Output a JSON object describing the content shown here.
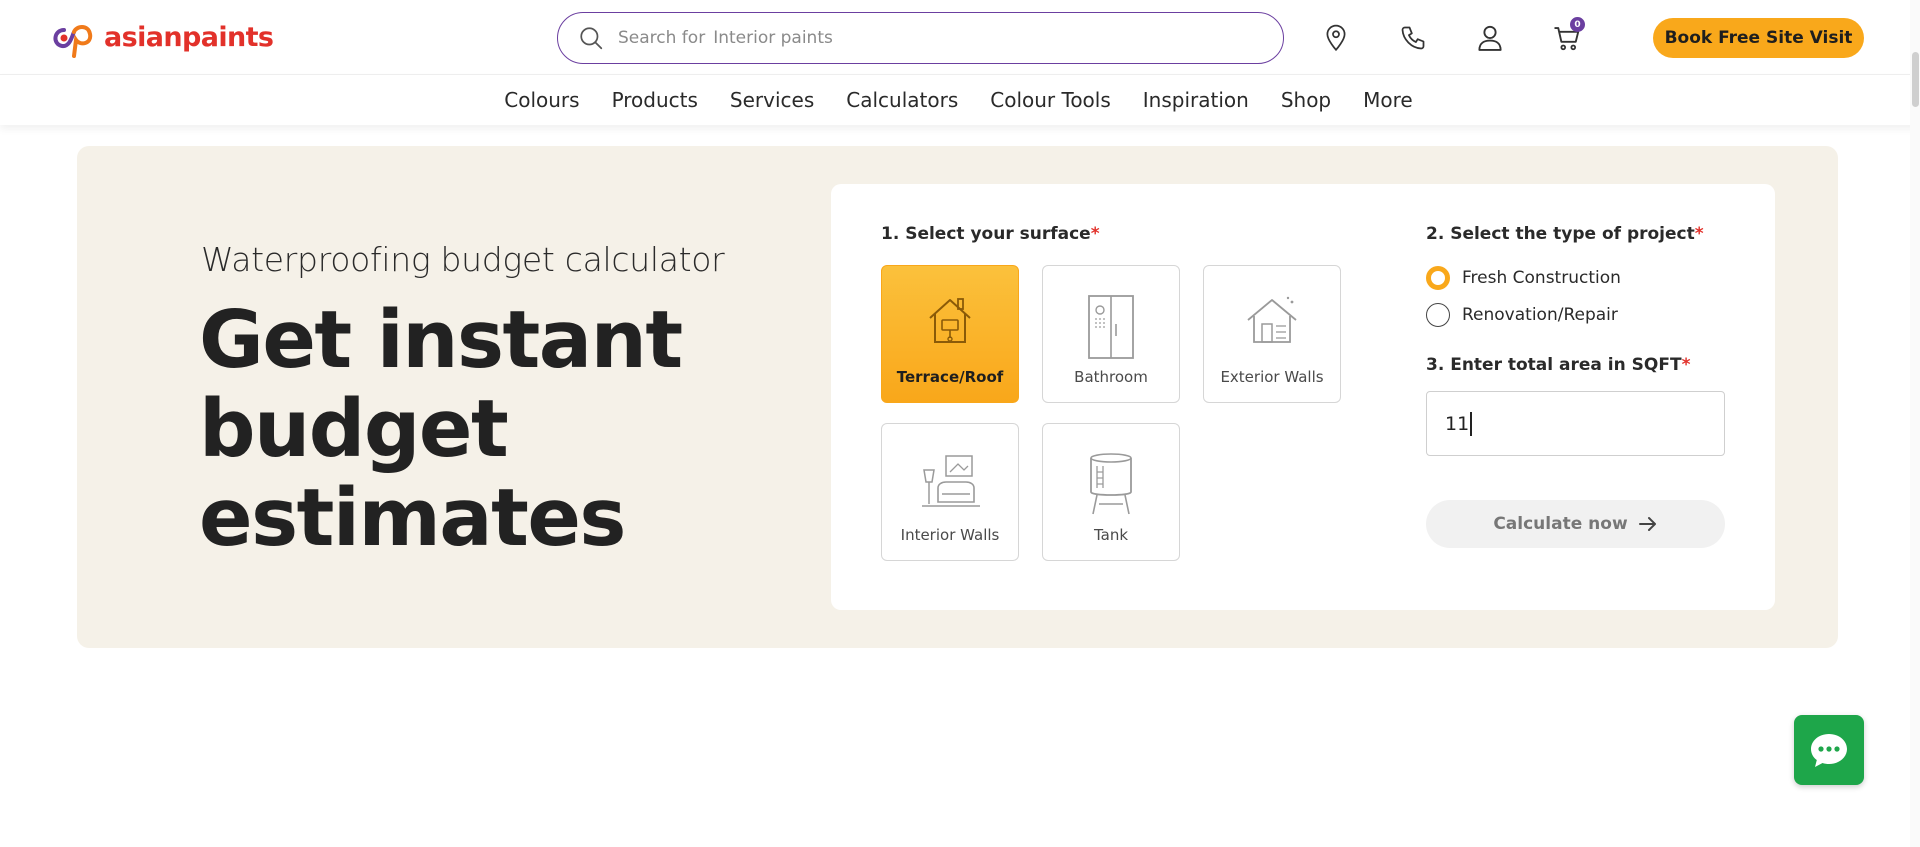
{
  "brand": {
    "name": "asianpaints"
  },
  "search": {
    "prefix": "Search for",
    "hint": "Interior paints"
  },
  "header": {
    "cart_count": "0",
    "book_button": "Book Free Site Visit",
    "icons": [
      "location-pin-icon",
      "phone-icon",
      "user-icon",
      "cart-icon"
    ]
  },
  "nav": {
    "items": [
      "Colours",
      "Products",
      "Services",
      "Calculators",
      "Colour Tools",
      "Inspiration",
      "Shop",
      "More"
    ]
  },
  "hero": {
    "subtitle": "Waterproofing budget calculator",
    "title": "Get instant budget estimates"
  },
  "form": {
    "step1": {
      "label": "1. Select your surface",
      "required": "*"
    },
    "surfaces": [
      {
        "label": "Terrace/Roof",
        "icon": "house-terrace-icon",
        "selected": true
      },
      {
        "label": "Bathroom",
        "icon": "shower-icon",
        "selected": false
      },
      {
        "label": "Exterior Walls",
        "icon": "house-exterior-icon",
        "selected": false
      },
      {
        "label": "Interior Walls",
        "icon": "sofa-lamp-icon",
        "selected": false
      },
      {
        "label": "Tank",
        "icon": "water-tank-icon",
        "selected": false
      }
    ],
    "step2": {
      "label": "2. Select the type of project",
      "required": "*"
    },
    "project_types": [
      {
        "label": "Fresh Construction",
        "checked": true
      },
      {
        "label": "Renovation/Repair",
        "checked": false
      }
    ],
    "step3": {
      "label": "3. Enter total area in SQFT",
      "required": "*"
    },
    "area_value": "11",
    "calculate_button": "Calculate now"
  },
  "colors": {
    "accent": "#f9a81b",
    "brand_red": "#e2312a",
    "brand_purple": "#6b3fa0",
    "hero_bg": "#f5f1e8",
    "chat_green": "#1ea64a"
  },
  "chat": {
    "icon": "chat-bubble-icon"
  }
}
